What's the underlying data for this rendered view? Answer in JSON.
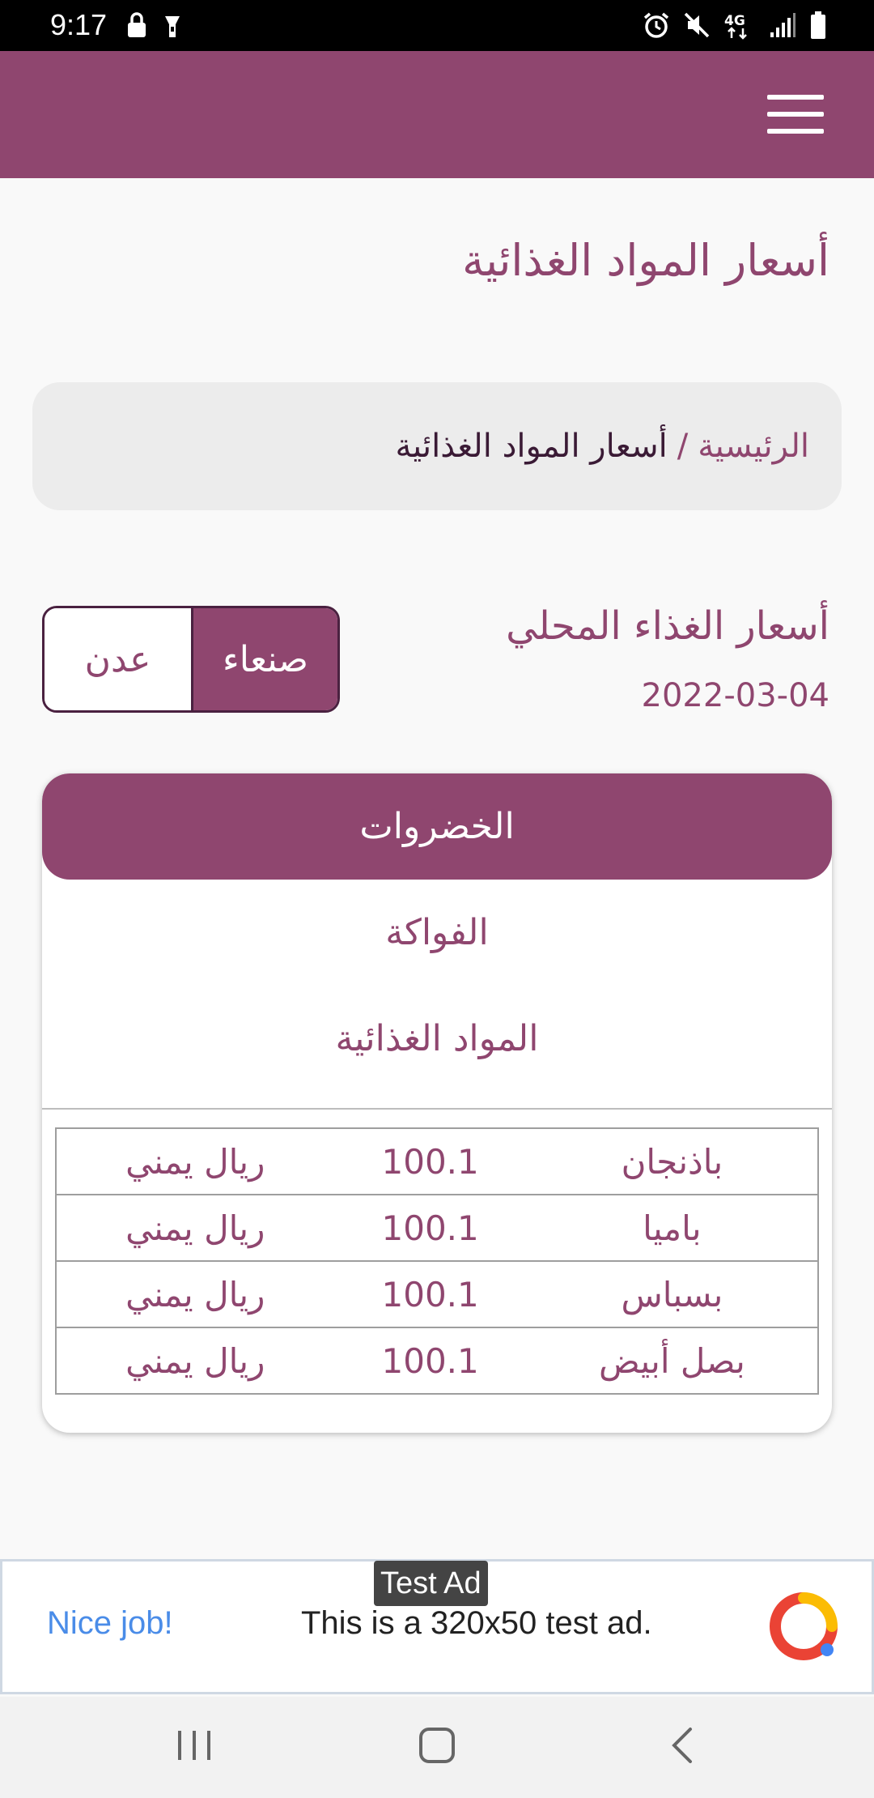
{
  "status_bar": {
    "time": "9:17",
    "left_icons": [
      "lock-icon",
      "flashlight-icon"
    ],
    "right_icons": [
      "alarm-icon",
      "mute-icon",
      "4g-icon",
      "signal-icon",
      "battery-icon"
    ],
    "network_label": "4G"
  },
  "app_bar": {
    "color": "#8f466f",
    "menu_icon": "hamburger-menu-icon"
  },
  "page": {
    "title": "أسعار المواد الغذائية"
  },
  "breadcrumb": {
    "home": "الرئيسية",
    "separator": "/",
    "current": "أسعار المواد الغذائية"
  },
  "section": {
    "title": "أسعار الغذاء المحلي",
    "date": "2022-03-04"
  },
  "city_toggle": {
    "active": "صنعاء",
    "inactive": "عدن"
  },
  "tabs": [
    {
      "label": "الخضروات",
      "active": true
    },
    {
      "label": "الفواكة",
      "active": false
    },
    {
      "label": "المواد الغذائية",
      "active": false
    }
  ],
  "price_table": {
    "rows": [
      {
        "item": "باذنجان",
        "price": "100.1",
        "currency": "ريال يمني"
      },
      {
        "item": "باميا",
        "price": "100.1",
        "currency": "ريال يمني"
      },
      {
        "item": "بسباس",
        "price": "100.1",
        "currency": "ريال يمني"
      },
      {
        "item": "بصل أبيض",
        "price": "100.1",
        "currency": "ريال يمني"
      }
    ]
  },
  "ad": {
    "tag": "Test Ad",
    "nice": "Nice job!",
    "text": "This is a 320x50 test ad.",
    "logo_icon": "admob-logo-icon"
  },
  "nav_bar": {
    "buttons": [
      "recent-apps-icon",
      "home-icon",
      "back-icon"
    ]
  },
  "colors": {
    "primary": "#8f466f",
    "dark": "#4a2140",
    "breadcrumb_bg": "#ececec"
  }
}
